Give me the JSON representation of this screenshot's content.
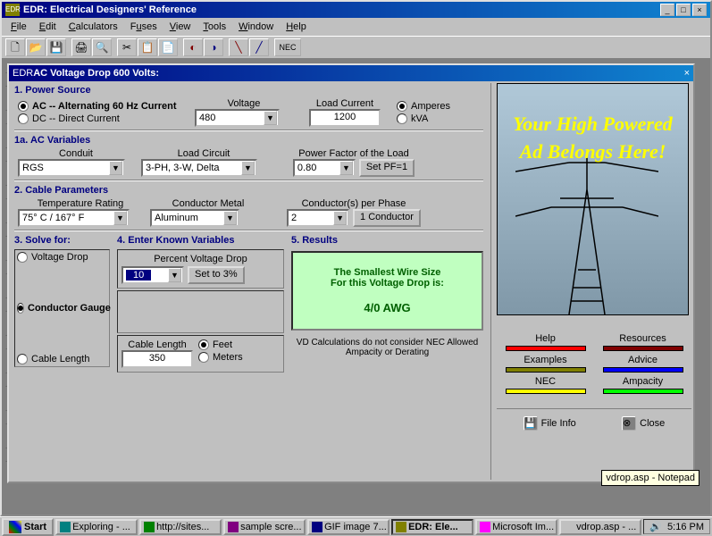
{
  "app": {
    "title": "EDR: Electrical Designers' Reference",
    "menu": [
      "File",
      "Edit",
      "Calculators",
      "Fuses",
      "View",
      "Tools",
      "Window",
      "Help"
    ]
  },
  "child": {
    "title": "AC Voltage Drop  600 Volts:"
  },
  "section1": {
    "header": "1.  Power Source",
    "ac_label": "AC -- Alternating 60 Hz Current",
    "dc_label": "DC -- Direct Current",
    "voltage_label": "Voltage",
    "voltage_value": "480",
    "load_current_label": "Load Current",
    "load_current_value": "1200",
    "amperes_label": "Amperes",
    "kva_label": "kVA"
  },
  "section1a": {
    "header": "1a.  AC Variables",
    "conduit_label": "Conduit",
    "conduit_value": "RGS",
    "load_circuit_label": "Load Circuit",
    "load_circuit_value": "3-PH, 3-W, Delta",
    "pf_label": "Power Factor of the Load",
    "pf_value": "0.80",
    "set_pf_btn": "Set PF=1"
  },
  "section2": {
    "header": "2.  Cable Parameters",
    "temp_label": "Temperature Rating",
    "temp_value": "75° C  /  167° F",
    "metal_label": "Conductor Metal",
    "metal_value": "Aluminum",
    "cpp_label": "Conductor(s) per Phase",
    "cpp_value": "2",
    "one_cond_btn": "1 Conductor"
  },
  "section3": {
    "header": "3.  Solve for:",
    "vd_label": "Voltage Drop",
    "cg_label": "Conductor Gauge",
    "cl_label": "Cable Length"
  },
  "section4": {
    "header": "4.  Enter Known Variables",
    "pvd_label": "Percent Voltage Drop",
    "pvd_value": "10",
    "set3_btn": "Set to 3%",
    "cable_len_label": "Cable Length",
    "cable_len_value": "350",
    "feet_label": "Feet",
    "meters_label": "Meters"
  },
  "section5": {
    "header": "5.  Results",
    "line1": "The Smallest Wire Size",
    "line2": "For this Voltage Drop is:",
    "result": "4/0 AWG",
    "note": "VD Calculations do not consider NEC Allowed Ampacity or Derating"
  },
  "ad": {
    "text": "Your High Powered Ad Belongs Here!"
  },
  "links": {
    "help": "Help",
    "resources": "Resources",
    "examples": "Examples",
    "advice": "Advice",
    "nec": "NEC",
    "ampacity": "Ampacity"
  },
  "bottom": {
    "fileinfo": "File Info",
    "close": "Close"
  },
  "tooltip": "vdrop.asp - Notepad",
  "taskbar": {
    "start": "Start",
    "tasks": [
      "Exploring - ...",
      "http://sites...",
      "sample scre...",
      "GIF image 7...",
      "EDR: Ele...",
      "Microsoft Im...",
      "vdrop.asp - ..."
    ],
    "time": "5:16 PM"
  }
}
